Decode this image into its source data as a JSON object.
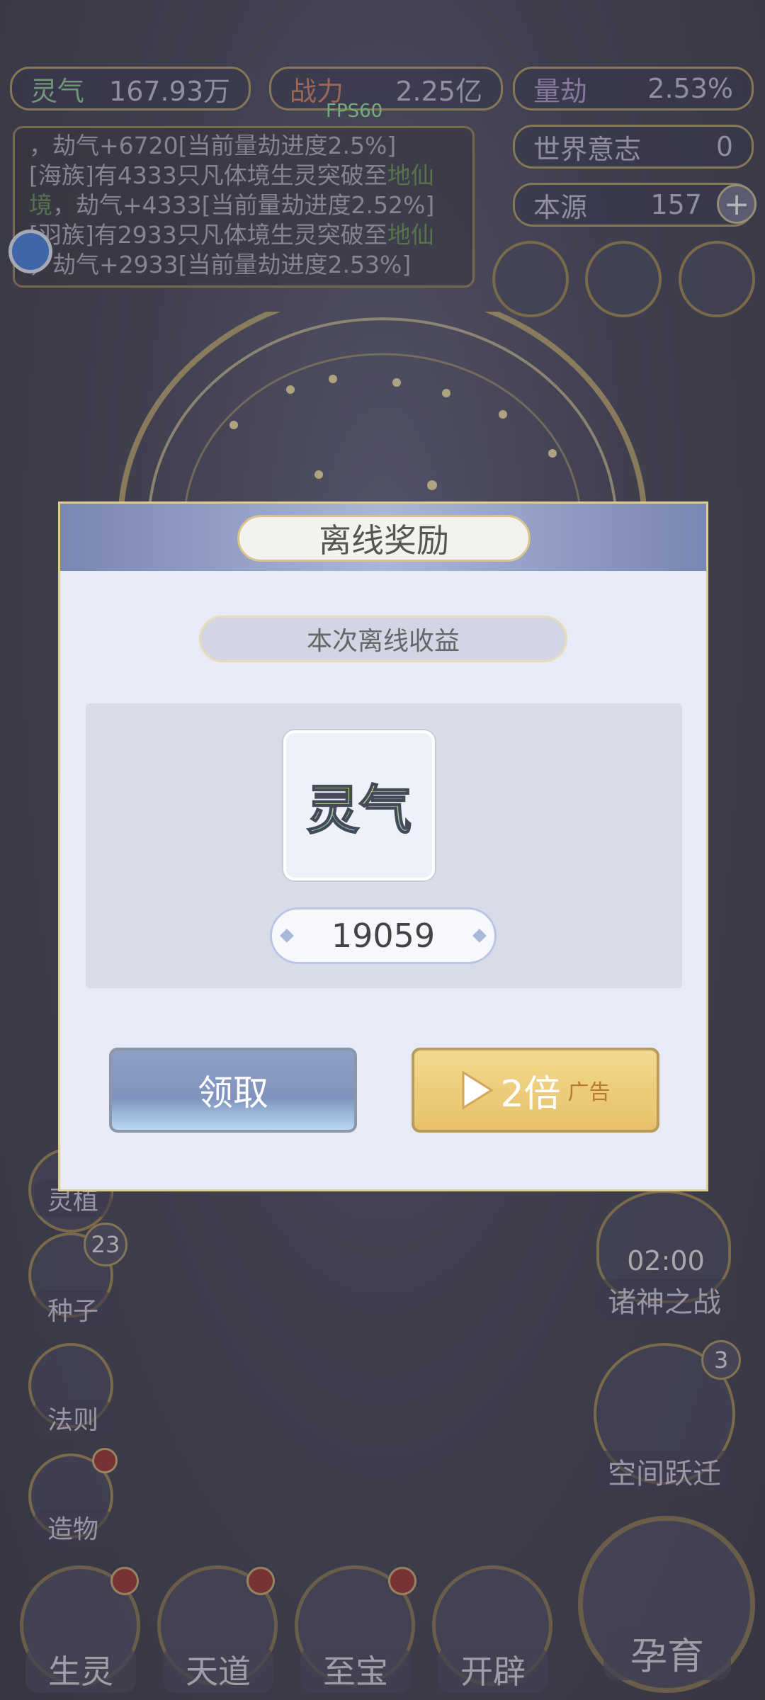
{
  "hud": {
    "fps": "FPS60",
    "resources": [
      {
        "key": "灵气",
        "value": "167.93万"
      },
      {
        "key": "战力",
        "value": "2.25亿"
      },
      {
        "key": "量劫",
        "value": "2.53%"
      },
      {
        "key": "世界意志",
        "value": "0"
      },
      {
        "key": "本源",
        "value": "157"
      }
    ],
    "add_glyph": "+"
  },
  "log": {
    "line0": "，劫气+6720[当前量劫进度2.5%]",
    "line1a": "[海族]有4333只凡体境生灵突破至",
    "line1g": "地仙",
    "line2g": "境",
    "line2b": "，劫气+4333[当前量劫进度2.52%]",
    "line3a": "[羽族]有2933只凡体境生灵突破至",
    "line3g": "地仙",
    "line4b": "，劫气+2933[当前量劫进度2.53%]"
  },
  "side_menu": [
    {
      "label": "灵植"
    },
    {
      "label": "种子",
      "count": "23"
    },
    {
      "label": "法则"
    },
    {
      "label": "造物"
    }
  ],
  "right_menu": [
    {
      "timer": "02:00",
      "label": "诸神之战"
    },
    {
      "label": "空间跃迁",
      "count": "3"
    }
  ],
  "bottom_nav": [
    {
      "label": "生灵"
    },
    {
      "label": "天道"
    },
    {
      "label": "至宝"
    },
    {
      "label": "开辟"
    }
  ],
  "bottom_main": {
    "label": "孕育"
  },
  "modal": {
    "title": "离线奖励",
    "subtitle": "本次离线收益",
    "item_name": "灵气",
    "amount": "19059",
    "claim_label": "领取",
    "double_label": "2倍",
    "ad_label": "广告"
  }
}
